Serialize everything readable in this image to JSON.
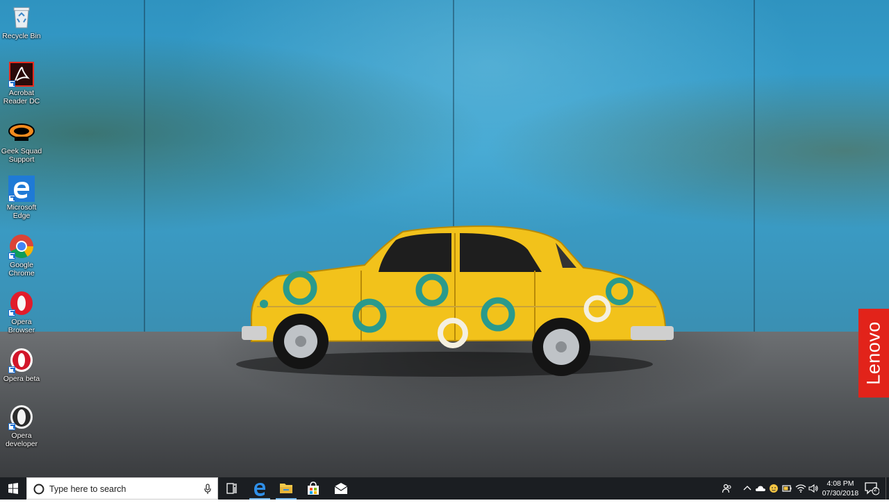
{
  "desktop_icons": [
    {
      "label": "Recycle Bin",
      "icon": "recycle-bin-icon"
    },
    {
      "label": "Acrobat Reader DC",
      "icon": "acrobat-reader-icon"
    },
    {
      "label": "Geek Squad Support",
      "icon": "geek-squad-icon"
    },
    {
      "label": "Microsoft Edge",
      "icon": "edge-icon"
    },
    {
      "label": "Google Chrome",
      "icon": "chrome-icon"
    },
    {
      "label": "Opera Browser",
      "icon": "opera-icon"
    },
    {
      "label": "Opera beta",
      "icon": "opera-beta-icon"
    },
    {
      "label": "Opera developer",
      "icon": "opera-developer-icon"
    }
  ],
  "wallpaper": {
    "brand": "Lenovo",
    "colors": {
      "wall": "#3aa2cf",
      "floor": "#505356",
      "car": "#f2c21b",
      "circles": "#2a9a8c",
      "brand": "#e2231a"
    }
  },
  "taskbar": {
    "search_placeholder": "Type here to search",
    "pinned": [
      {
        "name": "task-view",
        "icon": "task-view-icon"
      },
      {
        "name": "edge",
        "icon": "edge-icon"
      },
      {
        "name": "file-explorer",
        "icon": "folder-icon"
      },
      {
        "name": "store",
        "icon": "store-icon"
      },
      {
        "name": "mail",
        "icon": "mail-icon"
      }
    ],
    "tray_icons": [
      "people-icon",
      "chevron-up-icon",
      "onedrive-cloud-icon",
      "emoji-status-icon",
      "battery-icon",
      "wifi-icon",
      "volume-icon"
    ],
    "time": "4:08 PM",
    "date": "07/30/2018",
    "notification_count": "2",
    "colors": {
      "taskbar": "#1b1e22",
      "active_indicator": "#76b9ed"
    }
  }
}
